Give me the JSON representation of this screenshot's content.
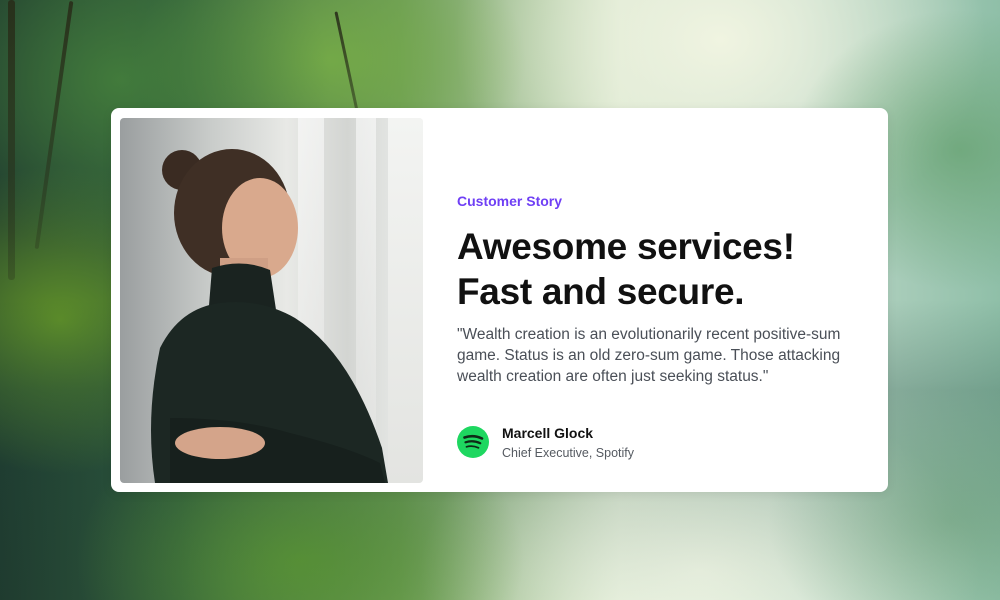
{
  "card": {
    "eyebrow": "Customer Story",
    "headline_line1": "Awesome services!",
    "headline_line2": "Fast and secure.",
    "quote": "\"Wealth creation is an evolutionarily recent positive-sum game. Status is an old zero-sum game. Those attacking wealth creation are often just seeking status.\"",
    "author": {
      "name": "Marcell Glock",
      "role": "Chief Executive, Spotify",
      "logo_icon": "spotify-logo-icon"
    },
    "photo_icon": "woman-portrait-image"
  },
  "colors": {
    "accent": "#6f3ff5",
    "spotify_green": "#1ed760",
    "headline": "#111111",
    "body": "#4a4f57"
  }
}
